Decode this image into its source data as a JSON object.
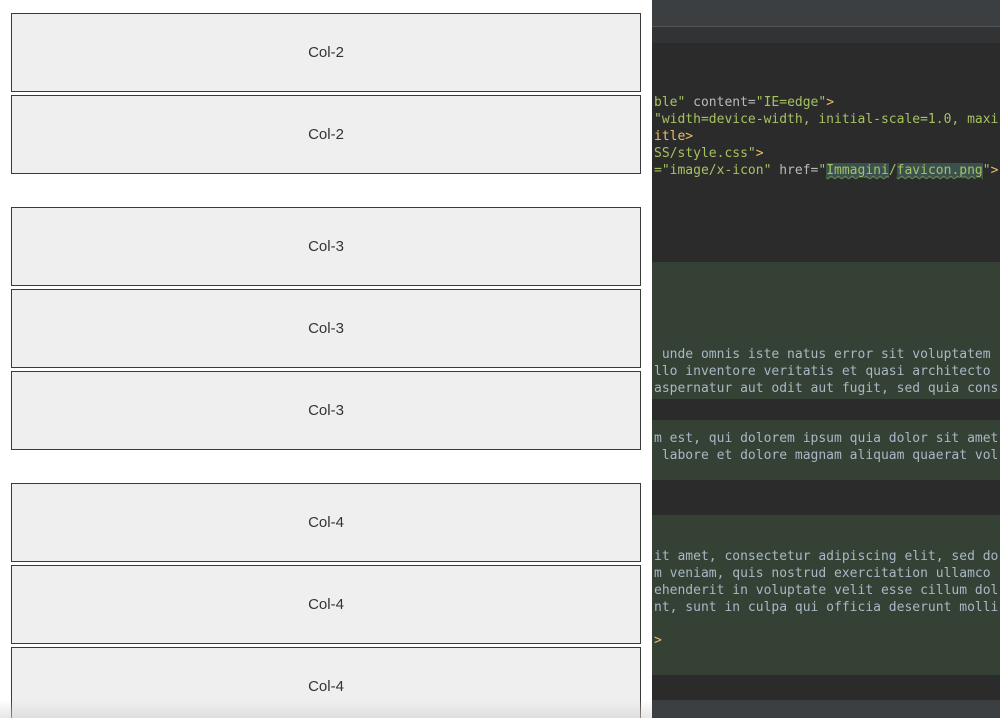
{
  "preview": {
    "rows": [
      {
        "label": "Col-2"
      },
      {
        "label": "Col-2"
      },
      {
        "label": "Col-3"
      },
      {
        "label": "Col-3"
      },
      {
        "label": "Col-3"
      },
      {
        "label": "Col-4"
      },
      {
        "label": "Col-4"
      },
      {
        "label": "Col-4"
      }
    ]
  },
  "editor": {
    "l1a": "ble\"",
    "l1b": " content=",
    "l1c": "\"IE=edge\"",
    "l1d": ">",
    "l2a": "\"width=device-width, initial-scale=1.0, maxi",
    "l3a": "itle>",
    "l4a": "SS/style.css\"",
    "l4b": ">",
    "l5a": "=\"image/x-icon\"",
    "l5b": " href=",
    "l5c": "\"",
    "l5d": "Immagini",
    "l5e": "/",
    "l5f": "favicon.png",
    "l5g": "\"",
    "l5h": ">",
    "p1": " unde omnis iste natus error sit voluptatem",
    "p2": "llo inventore veritatis et quasi architecto",
    "p3": "aspernatur aut odit aut fugit, sed quia cons",
    "p4": "m est, qui dolorem ipsum quia dolor sit amet",
    "p5": " labore et dolore magnam aliquam quaerat vol",
    "p6": "it amet, consectetur adipiscing elit, sed do",
    "p7": "m veniam, quis nostrud exercitation ullamco",
    "p8": "ehenderit in voluptate velit esse cillum dol",
    "p9": "nt, sunt in culpa qui officia deserunt molli",
    "p10": ">"
  }
}
